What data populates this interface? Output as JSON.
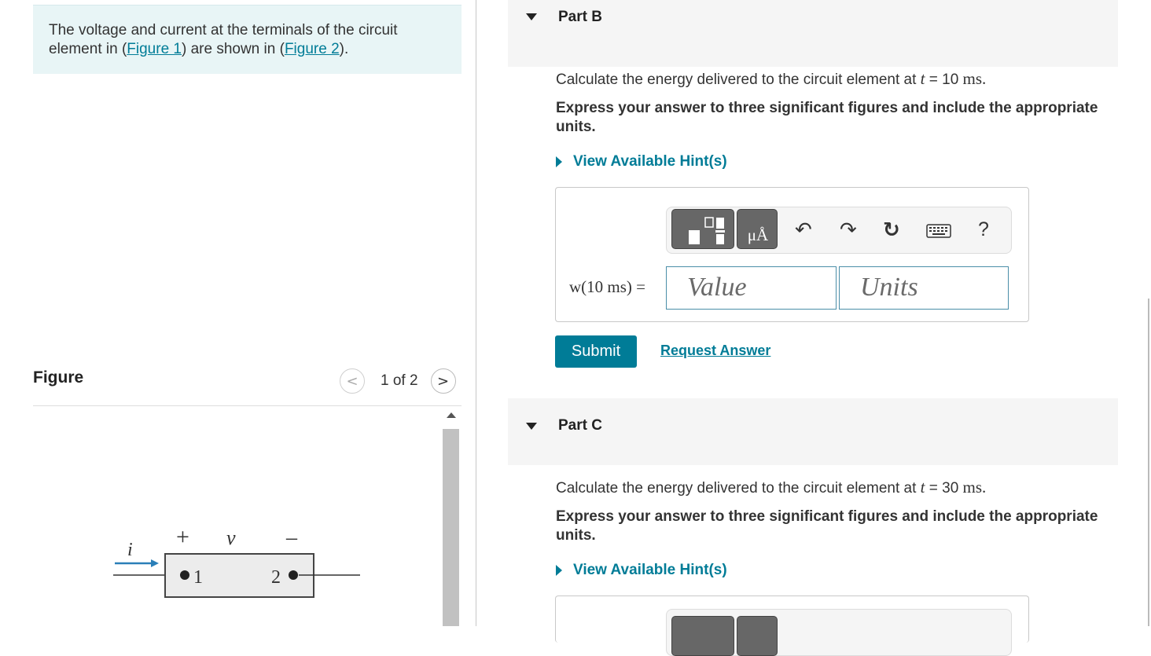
{
  "problem": {
    "text_before": "The voltage and current at the terminals of the circuit element in (",
    "figure1_link": "Figure 1",
    "text_middle": ") are shown in (",
    "figure2_link": "Figure 2",
    "text_after": ")."
  },
  "figure_panel": {
    "title": "Figure",
    "prev_icon": "<",
    "next_icon": ">",
    "counter": "1 of 2",
    "circuit": {
      "current_label": "i",
      "plus_label": "+",
      "voltage_label": "v",
      "minus_label": "–",
      "terminal1_label": "1",
      "terminal2_label": "2"
    }
  },
  "partB": {
    "label": "Part B",
    "question_prefix": "Calculate the energy delivered to the circuit element at",
    "question_var": "t",
    "question_eq": " = 10",
    "question_unit": " ms.",
    "instruction": "Express your answer to three significant figures and include the appropriate units.",
    "hint_label": "View Available Hint(s)",
    "eq_label": "w(10 ms) =",
    "value_placeholder": "Value",
    "units_placeholder": "Units",
    "submit_label": "Submit",
    "request_label": "Request Answer",
    "toolbar": {
      "template_icon": "fraction-template-icon",
      "units_icon": "units-icon",
      "units_text": "μÅ",
      "undo_glyph": "↶",
      "redo_glyph": "↷",
      "reset_glyph": "↻",
      "keyboard_icon": "keyboard-icon",
      "help_glyph": "?"
    }
  },
  "partC": {
    "label": "Part C",
    "question_prefix": "Calculate the energy delivered to the circuit element at",
    "question_var": "t",
    "question_eq": " = 30",
    "question_unit": " ms.",
    "instruction": "Express your answer to three significant figures and include the appropriate units.",
    "hint_label": "View Available Hint(s)"
  },
  "colors": {
    "accent": "#007c97",
    "problem_bg": "#e8f5f6",
    "header_bg": "#f5f5f5"
  }
}
